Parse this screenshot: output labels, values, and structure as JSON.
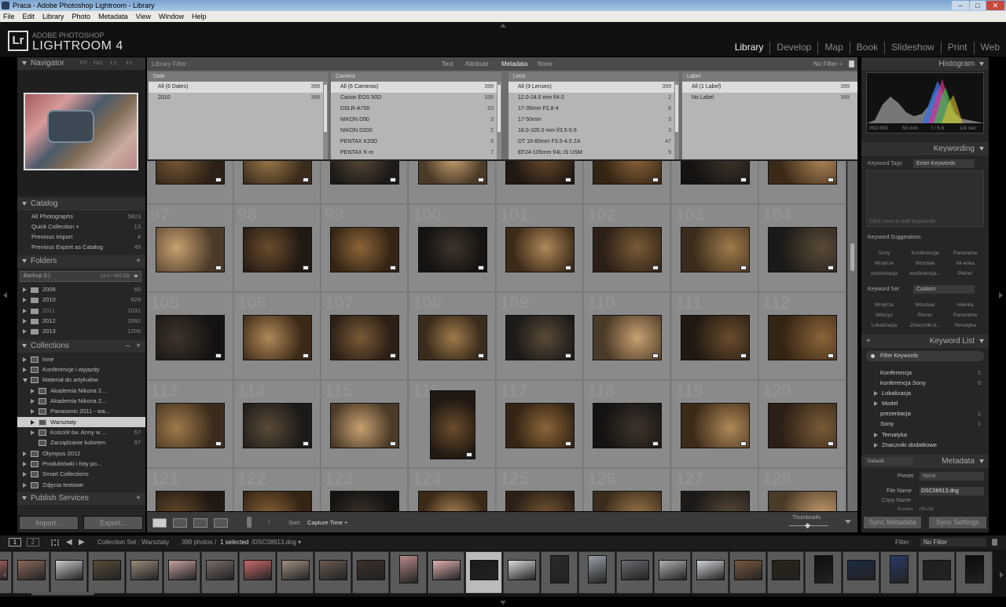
{
  "window": {
    "title": "Praca - Adobe Photoshop Lightroom - Library"
  },
  "menu": [
    "File",
    "Edit",
    "Library",
    "Photo",
    "Metadata",
    "View",
    "Window",
    "Help"
  ],
  "brand": {
    "logo": "Lr",
    "adobe": "ADOBE PHOTOSHOP",
    "name": "LIGHTROOM 4"
  },
  "modules": [
    "Library",
    "Develop",
    "Map",
    "Book",
    "Slideshow",
    "Print",
    "Web"
  ],
  "navigator": {
    "title": "Navigator",
    "fit": "FIT",
    "fill": "FILL",
    "z1": "1:1",
    "z3": "3:1"
  },
  "catalog": {
    "title": "Catalog",
    "items": [
      {
        "label": "All Photographs",
        "count": "5823"
      },
      {
        "label": "Quick Collection +",
        "count": "13"
      },
      {
        "label": "Previous Import",
        "count": "4"
      },
      {
        "label": "Previous Export as Catalog",
        "count": "49"
      }
    ]
  },
  "folders": {
    "title": "Folders",
    "volume": "Backup (I:)",
    "volume_info": "13.4 / 465 GB",
    "items": [
      {
        "label": "2009",
        "count": "65"
      },
      {
        "label": "2010",
        "count": "929"
      },
      {
        "label": "2011",
        "count": "1031"
      },
      {
        "label": "2012",
        "count": "2592"
      },
      {
        "label": "2013",
        "count": "1206"
      }
    ]
  },
  "collections": {
    "title": "Collections",
    "items": [
      {
        "label": "Inne",
        "count": ""
      },
      {
        "label": "Konferencje i wyjazdy",
        "count": ""
      },
      {
        "label": "Materiał do artykułów",
        "count": ""
      },
      {
        "label": "Akademia Nikona 2...",
        "count": ""
      },
      {
        "label": "Akademia Nikona 2...",
        "count": ""
      },
      {
        "label": "Panasonic 2011 - wa...",
        "count": ""
      },
      {
        "label": "Warsztaty",
        "count": ""
      },
      {
        "label": "Kościół św. Anny w ...",
        "count": "67"
      },
      {
        "label": "Zarządzanie kolorem",
        "count": "97"
      },
      {
        "label": "Olympus 2012",
        "count": ""
      },
      {
        "label": "Produktówki i foty po...",
        "count": ""
      },
      {
        "label": "Smart Collections",
        "count": ""
      },
      {
        "label": "Zdjęcia testowe",
        "count": ""
      }
    ]
  },
  "publish": {
    "title": "Publish Services"
  },
  "left_buttons": {
    "import": "Import...",
    "export": "Export..."
  },
  "library_filter": {
    "title": "Library Filter :",
    "tabs": [
      "Text",
      "Attribute",
      "Metadata",
      "None"
    ],
    "preset": "No Filter ÷"
  },
  "filter_columns": [
    {
      "header": "Date",
      "rows": [
        {
          "label": "All (6 Dates)",
          "count": "399"
        },
        {
          "label": "2010",
          "count": "399"
        }
      ]
    },
    {
      "header": "Camera",
      "rows": [
        {
          "label": "All (6 Cameras)",
          "count": "399"
        },
        {
          "label": "Canon EOS 50D",
          "count": "335"
        },
        {
          "label": "DSLR-A700",
          "count": "53"
        },
        {
          "label": "NIKON D90",
          "count": "3"
        },
        {
          "label": "NIKON D200",
          "count": "2"
        },
        {
          "label": "PENTAX K20D",
          "count": "3"
        },
        {
          "label": "PENTAX K-m",
          "count": "7"
        }
      ]
    },
    {
      "header": "Lens",
      "rows": [
        {
          "label": "All (9 Lenses)",
          "count": "399"
        },
        {
          "label": "12.0-24.0 mm f/4.0",
          "count": "2"
        },
        {
          "label": "17-35mm F2.8-4",
          "count": "6"
        },
        {
          "label": "17-50mm",
          "count": "3"
        },
        {
          "label": "18.0-105.0 mm f/3.5-5.6",
          "count": "3"
        },
        {
          "label": "DT 16-80mm F3.5-4.5 ZA",
          "count": "47"
        },
        {
          "label": "EF24-105mm f/4L IS USM",
          "count": "9"
        }
      ]
    },
    {
      "header": "Label",
      "rows": [
        {
          "label": "All (1 Label)",
          "count": "399"
        },
        {
          "label": "No Label",
          "count": "399"
        }
      ]
    }
  ],
  "grid": {
    "row_numbers": [
      [
        "",
        "",
        "",
        "",
        "",
        "",
        "",
        "",
        ""
      ],
      [
        "97",
        "98",
        "99",
        "100",
        "101",
        "102",
        "103",
        "104",
        ""
      ],
      [
        "105",
        "106",
        "107",
        "108",
        "109",
        "110",
        "111",
        "112",
        ""
      ],
      [
        "113",
        "114",
        "115",
        "116",
        "117",
        "118",
        "119",
        "120",
        ""
      ],
      [
        "121",
        "122",
        "123",
        "124",
        "125",
        "126",
        "127",
        "128",
        ""
      ]
    ]
  },
  "toolbar": {
    "sort_label": "Sort:",
    "sort_value": "Capture Time ÷",
    "thumbs_label": "Thumbnails"
  },
  "histogram": {
    "title": "Histogram",
    "iso": "ISO 800",
    "focal": "50 mm",
    "aperture": "f / 5.6",
    "shutter": "1/4 sec"
  },
  "keywording": {
    "title": "Keywording",
    "tags_label": "Keyword Tags",
    "tags_value": "Enter Keywords",
    "placeholder": "Click here to add keywords",
    "suggestions_title": "Keyword Suggestions",
    "suggestions": [
      "Sony",
      "Konferencja",
      "Panorama",
      "Wnętrze",
      "Wrocław",
      "Ali-enka",
      "prezentacja",
      "konferencja...",
      "Plener"
    ],
    "set_label": "Keyword Set",
    "set_value": "Custom",
    "set_items": [
      "Wnętrze",
      "Wrocław",
      "Alienka",
      "Wilczyc",
      "Plener",
      "Panorama",
      "Lokalizacja",
      "Znaczniki d...",
      "Tematyka"
    ]
  },
  "keyword_list": {
    "title": "Keyword List",
    "filter": "Filter Keywords",
    "items": [
      {
        "label": "Konferencja",
        "count": "1",
        "expand": false
      },
      {
        "label": "konferencja Sony",
        "count": "0",
        "expand": false
      },
      {
        "label": "Lokalizacja",
        "count": "",
        "expand": true
      },
      {
        "label": "Model",
        "count": "",
        "expand": true
      },
      {
        "label": "prezentacja",
        "count": "1",
        "expand": false
      },
      {
        "label": "Sony",
        "count": "1",
        "expand": false
      },
      {
        "label": "Tematyka",
        "count": "",
        "expand": true
      },
      {
        "label": "Znaczniki dodatkowe",
        "count": "",
        "expand": true
      }
    ]
  },
  "metadata": {
    "title": "Metadata",
    "preset_dropdown": "Default",
    "preset_label": "Preset",
    "preset_value": "None",
    "filename_label": "File Name",
    "filename_value": "DSC08913.dng",
    "copyname_label": "Copy Name",
    "folder_label": "Folder",
    "folder_value": "05-06"
  },
  "sync": {
    "metadata": "Sync Metadata",
    "settings": "Sync Settings"
  },
  "filmstrip_bar": {
    "page1": "1",
    "page2": "2",
    "path": "Collection Set : Warsztaty",
    "count": "399 photos /",
    "selected": "1 selected",
    "file": "/DSC08913.dng ▾",
    "filter_label": "Filter :",
    "filter_value": "No Filter"
  },
  "colors": {
    "accent": "#d8d8d8",
    "panel": "#262626",
    "grid": "#7e7e7e"
  }
}
